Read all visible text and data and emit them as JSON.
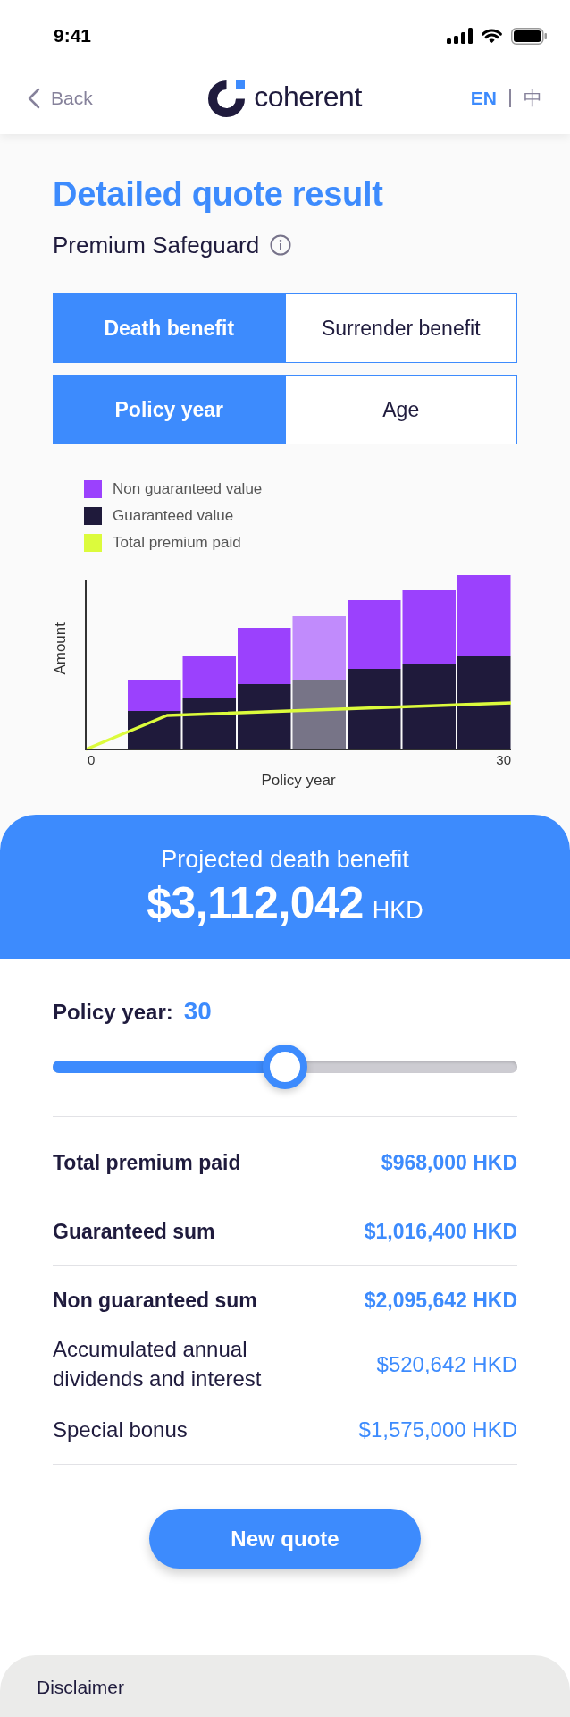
{
  "status_bar": {
    "time": "9:41"
  },
  "nav": {
    "back_label": "Back",
    "logo_text": "coherent",
    "languages": [
      {
        "label": "EN",
        "selected": true
      },
      {
        "label": "中",
        "selected": false
      }
    ]
  },
  "page": {
    "title": "Detailed quote result",
    "product": "Premium Safeguard"
  },
  "benefit_tabs": [
    {
      "label": "Death benefit",
      "selected": true
    },
    {
      "label": "Surrender benefit",
      "selected": false
    }
  ],
  "axis_tabs": [
    {
      "label": "Policy year",
      "selected": true
    },
    {
      "label": "Age",
      "selected": false
    }
  ],
  "chart": {
    "legend": [
      {
        "label": "Non guaranteed value",
        "color": "#9b41fd"
      },
      {
        "label": "Guaranteed value",
        "color": "#1f1a3b"
      },
      {
        "label": "Total premium paid",
        "color": "#dcfb3c"
      }
    ],
    "ylabel": "Amount",
    "xlabel": "Policy year",
    "xticks": [
      "0",
      "30"
    ],
    "bars": [
      {
        "selected": false
      },
      {
        "selected": false
      },
      {
        "selected": false
      },
      {
        "selected": true
      },
      {
        "selected": false
      },
      {
        "selected": false
      },
      {
        "selected": false
      }
    ]
  },
  "banner": {
    "label": "Projected death benefit",
    "amount": "$3,112,042",
    "currency": "HKD"
  },
  "policy_year": {
    "label": "Policy year:",
    "value": "30",
    "level": 0.5
  },
  "summary_rows": [
    {
      "kind": "main",
      "label": "Total premium paid",
      "value": "$968,000 HKD"
    },
    {
      "kind": "main",
      "label": "Guaranteed sum",
      "value": "$1,016,400 HKD"
    },
    {
      "kind": "main",
      "label": "Non guaranteed sum",
      "value": "$2,095,642 HKD"
    },
    {
      "kind": "sub",
      "label": "Accumulated annual dividends and interest",
      "value": "$520,642 HKD"
    },
    {
      "kind": "sub",
      "label": "Special bonus",
      "value": "$1,575,000 HKD"
    }
  ],
  "new_quote_button": {
    "label": "New quote"
  },
  "disclaimer": {
    "title": "Disclaimer"
  }
}
